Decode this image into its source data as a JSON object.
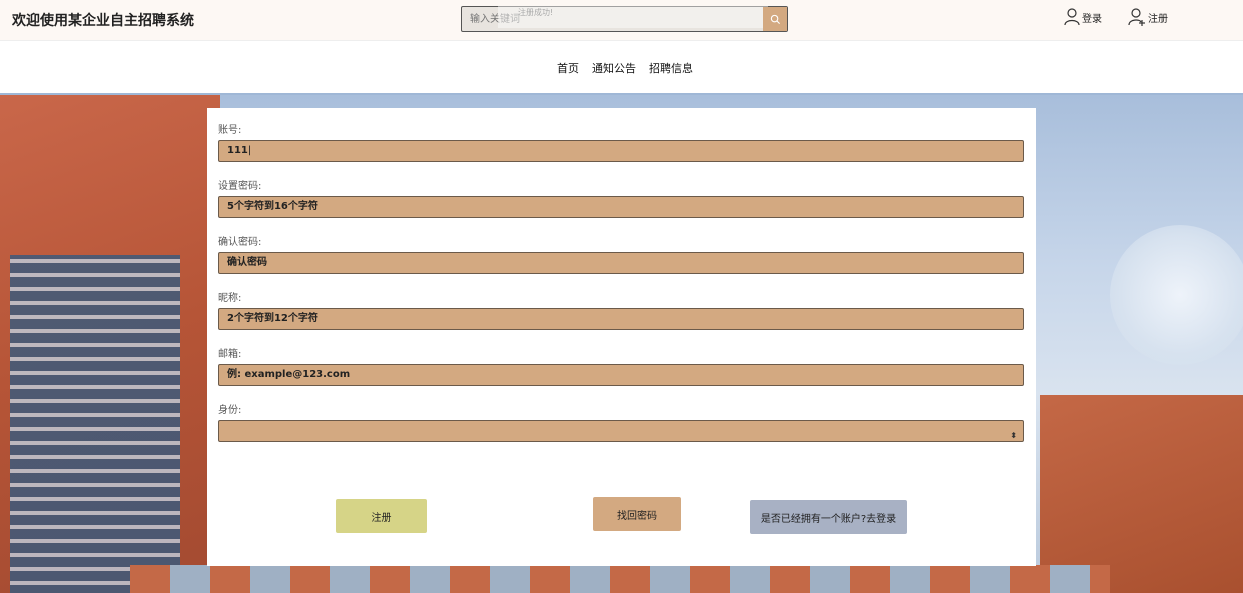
{
  "header": {
    "site_title": "欢迎使用某企业自主招聘系统",
    "search_placeholder": "输入关键词",
    "toast": "注册成功!",
    "login_label": "登录",
    "register_label": "注册"
  },
  "nav": {
    "items": [
      "首页",
      "通知公告",
      "招聘信息"
    ]
  },
  "form": {
    "account_label": "账号:",
    "account_value": "111",
    "password_label": "设置密码:",
    "password_placeholder": "5个字符到16个字符",
    "confirm_label": "确认密码:",
    "confirm_placeholder": "确认密码",
    "nickname_label": "昵称:",
    "nickname_placeholder": "2个字符到12个字符",
    "email_label": "邮箱:",
    "email_placeholder": "例: example@123.com",
    "identity_label": "身份:",
    "identity_value": "",
    "register_button": "注册",
    "recover_button": "找回密码",
    "login_link_button": "是否已经拥有一个账户?去登录"
  },
  "colors": {
    "field_bg": "#d3a981",
    "register_btn": "#d6d487",
    "recover_btn": "#d3a981",
    "login_btn": "#a8b1c4"
  }
}
